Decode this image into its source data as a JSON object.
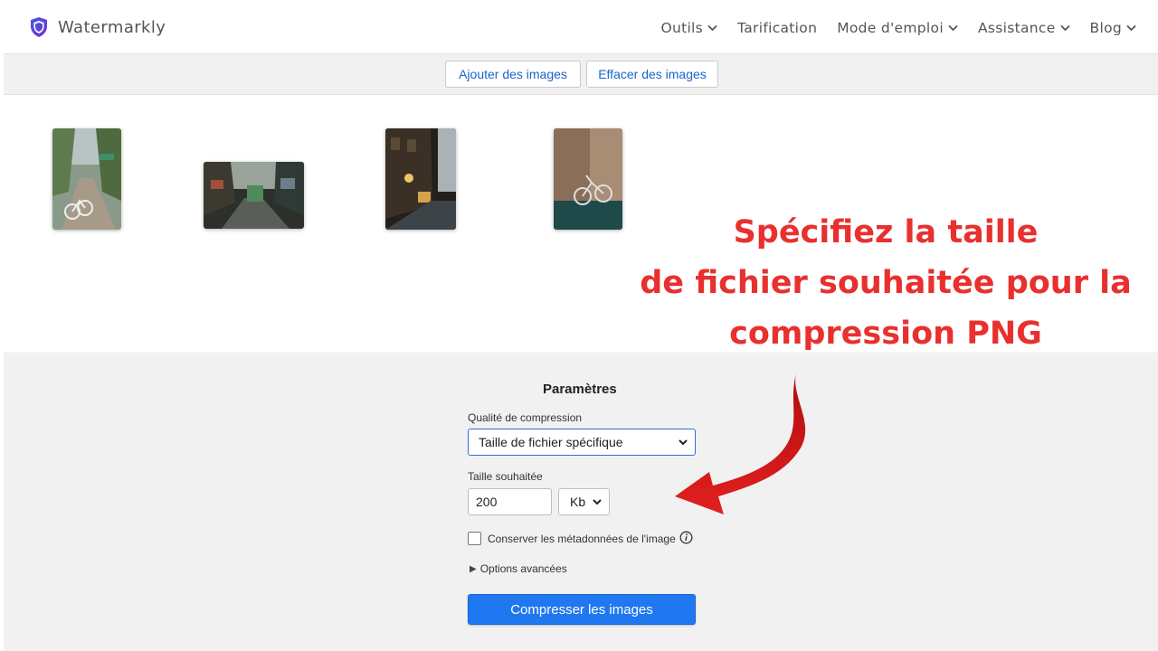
{
  "header": {
    "logo_icon": "shield-icon",
    "logo_text": "Watermarkly",
    "nav": [
      {
        "label": "Outils",
        "dropdown": true
      },
      {
        "label": "Tarification",
        "dropdown": false
      },
      {
        "label": "Mode d'emploi",
        "dropdown": true
      },
      {
        "label": "Assistance",
        "dropdown": true
      },
      {
        "label": "Blog",
        "dropdown": true
      }
    ]
  },
  "toolbar": {
    "add_label": "Ajouter des images",
    "clear_label": "Effacer des images"
  },
  "annotation": {
    "line1": "Spécifiez la taille",
    "line2": "de fichier souhaitée pour la",
    "line3": "compression PNG",
    "color": "#e8302e"
  },
  "settings": {
    "title": "Paramètres",
    "quality_label": "Qualité de compression",
    "quality_value": "Taille de fichier spécifique",
    "size_label": "Taille souhaitée",
    "size_value": "200",
    "unit_value": "Kb",
    "metadata_label": "Conserver les métadonnées de l'image",
    "metadata_checked": false,
    "advanced_label": "Options avancées",
    "compress_label": "Compresser les images"
  },
  "colors": {
    "accent": "#1f78f0",
    "link": "#1a64c8",
    "logo": "#5b3fd6"
  }
}
